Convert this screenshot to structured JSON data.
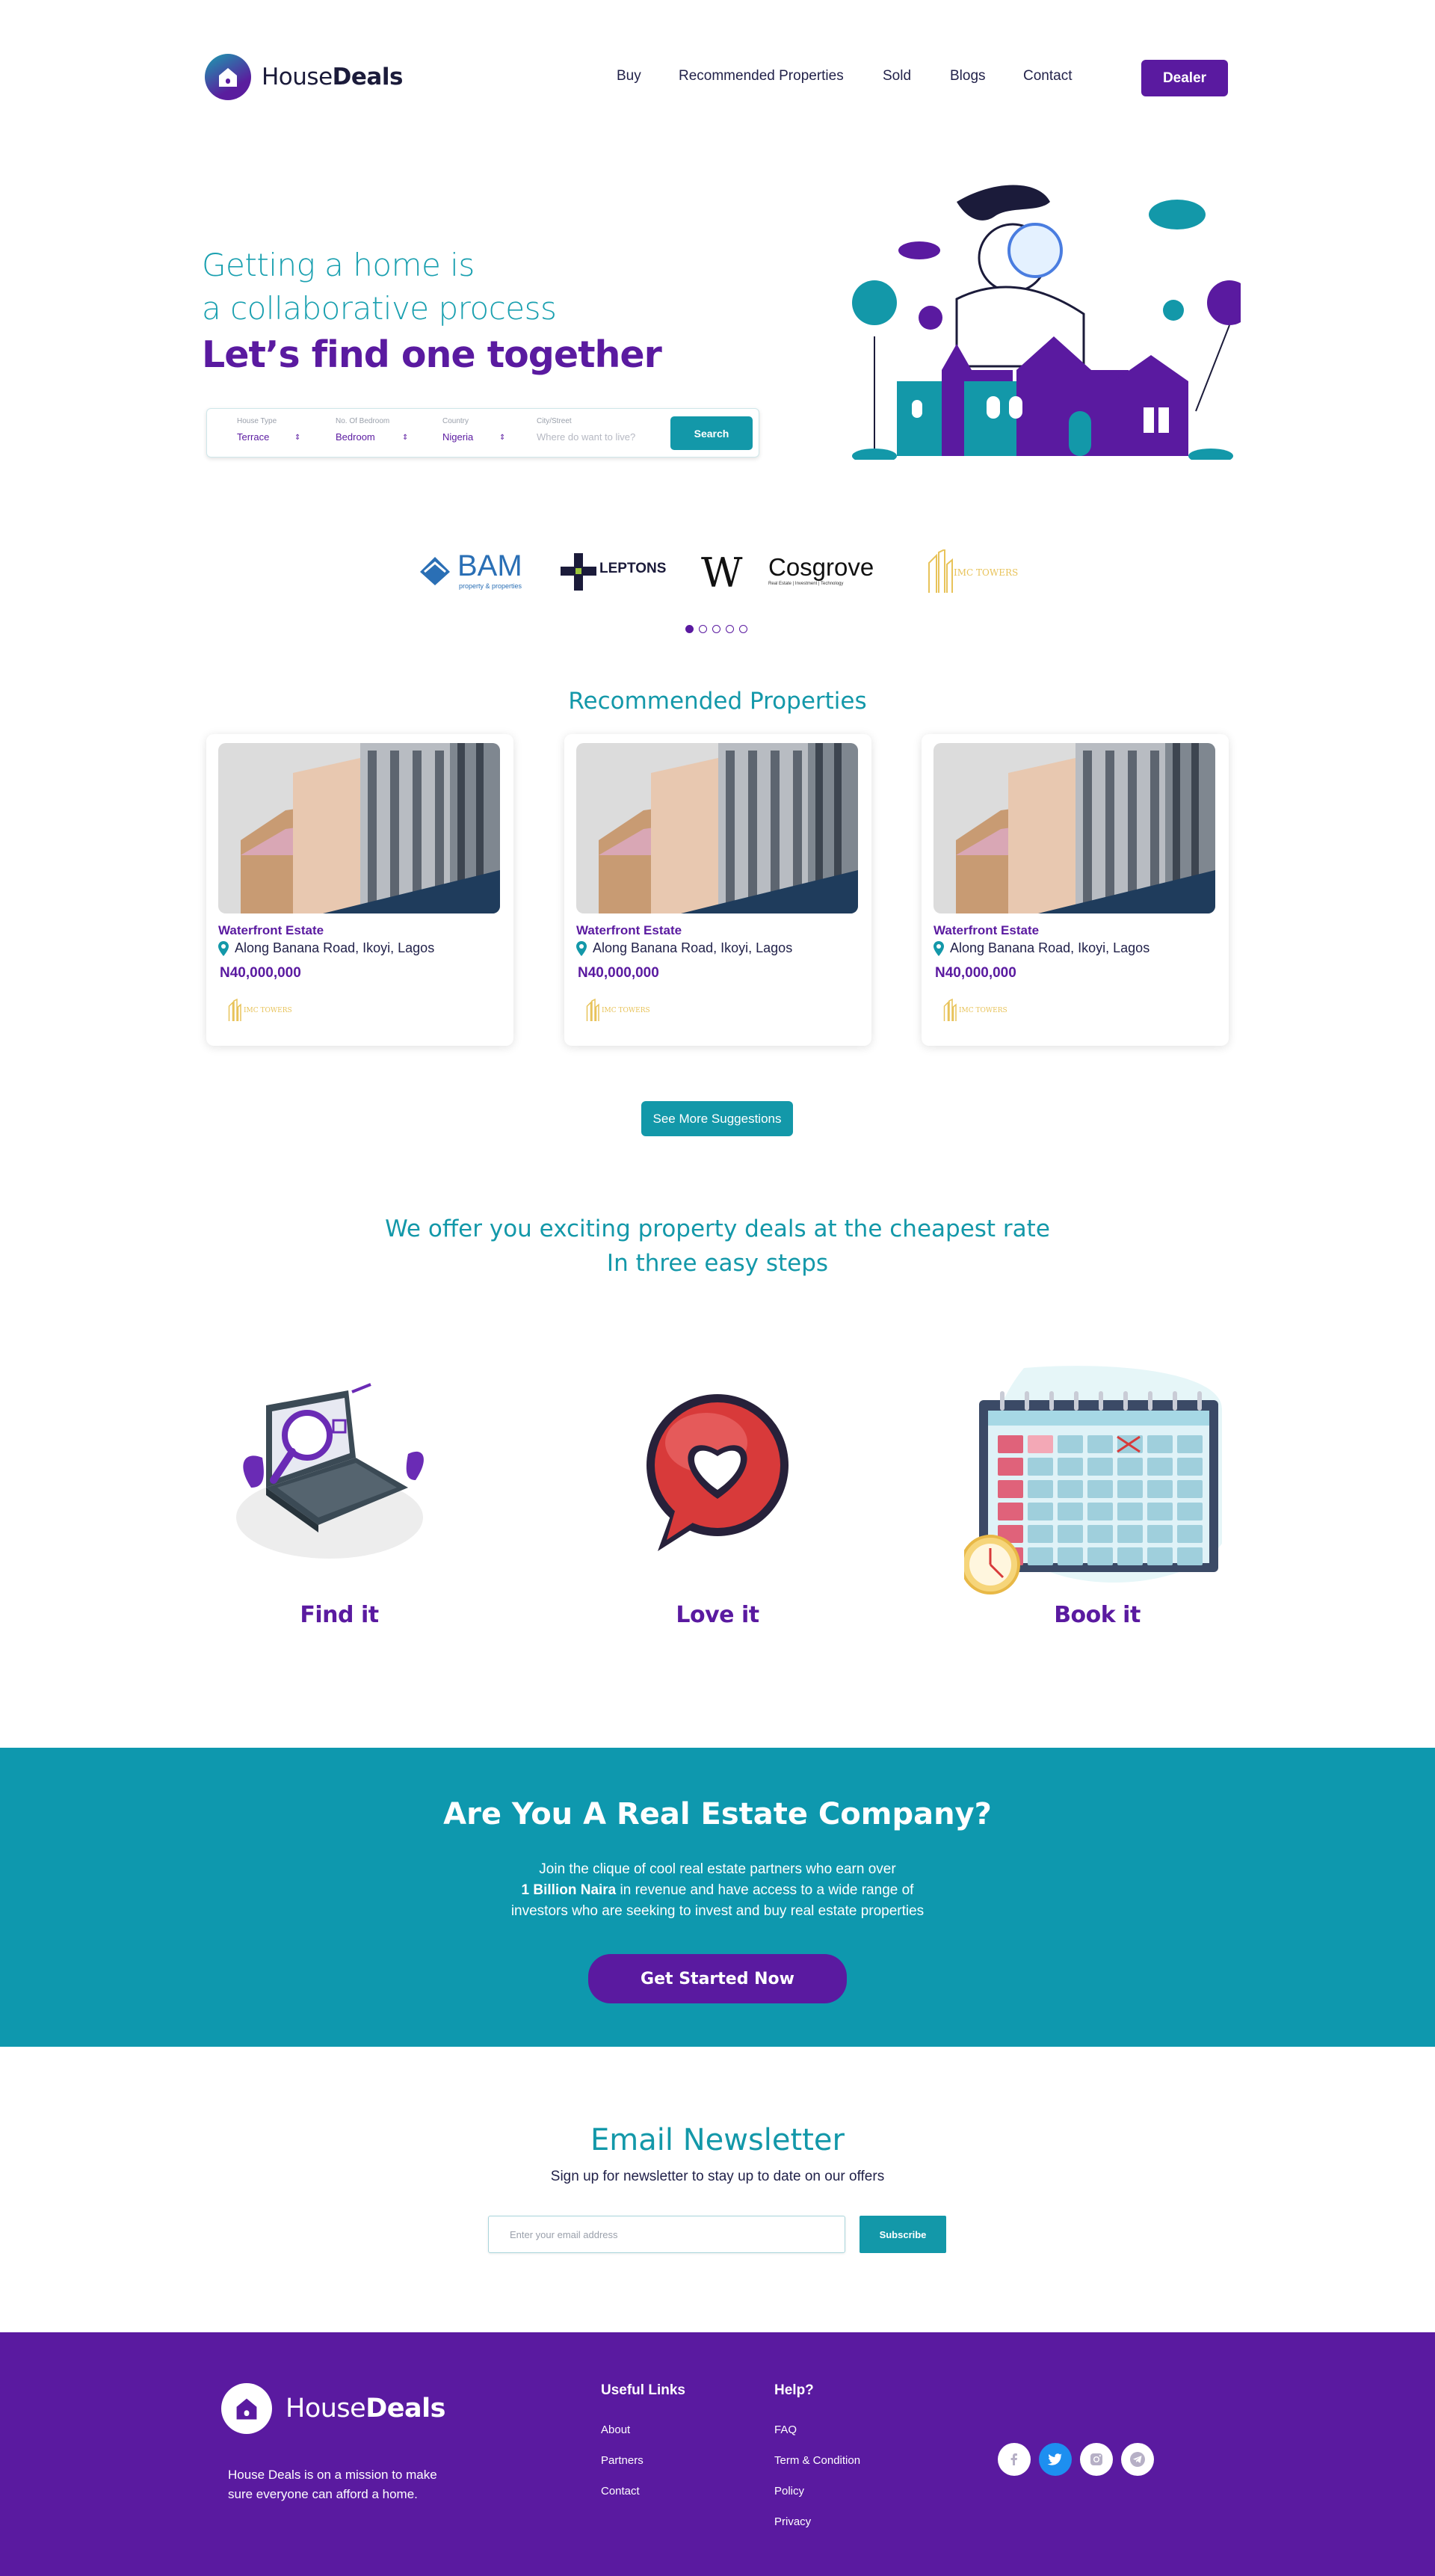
{
  "brand": {
    "name_light": "House",
    "name_bold": "Deals"
  },
  "nav": {
    "links": [
      "Buy",
      "Recommended Properties",
      "Sold",
      "Blogs",
      "Contact"
    ],
    "cta": "Dealer"
  },
  "hero": {
    "line1": "Getting a home is",
    "line2": "a collaborative process",
    "headline": "Let’s find one together"
  },
  "search": {
    "fields": [
      {
        "label": "House Type",
        "value": "Terrace"
      },
      {
        "label": "No. Of Bedroom",
        "value": "Bedroom"
      },
      {
        "label": "Country",
        "value": "Nigeria"
      }
    ],
    "city_label": "City/Street",
    "city_placeholder": "Where do want to live?",
    "button": "Search"
  },
  "partners": {
    "logos": [
      {
        "name": "BAM",
        "sub": "property & properties",
        "icon": "bam-logo"
      },
      {
        "name": "LEPTONS",
        "icon": "leptons-logo"
      },
      {
        "name": "W",
        "icon": "w-logo"
      },
      {
        "name": "Cosgrove",
        "sub": "Real Estate | Investment | Technology",
        "icon": "cosgrove-logo"
      },
      {
        "name": "IMC TOWERS",
        "icon": "imc-towers-logo"
      }
    ],
    "carousel_pages": 5,
    "active_page": 1
  },
  "recommended": {
    "title": "Recommended Properties",
    "cards": [
      {
        "name": "Waterfront Estate",
        "address": "Along Banana Road, Ikoyi, Lagos",
        "price": "N40,000,000",
        "partner": "IMC TOWERS"
      },
      {
        "name": "Waterfront Estate",
        "address": "Along Banana Road, Ikoyi, Lagos",
        "price": "N40,000,000",
        "partner": "IMC TOWERS"
      },
      {
        "name": "Waterfront Estate",
        "address": "Along Banana Road, Ikoyi, Lagos",
        "price": "N40,000,000",
        "partner": "IMC TOWERS"
      }
    ],
    "more_button": "See More Suggestions"
  },
  "offer": {
    "line1": "We offer you exciting property deals at the cheapest rate",
    "line2": "In three easy steps",
    "steps": [
      {
        "label": "Find it",
        "icon": "laptop-search-icon"
      },
      {
        "label": "Love it",
        "icon": "heart-chat-icon"
      },
      {
        "label": "Book it",
        "icon": "calendar-icon"
      }
    ]
  },
  "cta": {
    "title": "Are You A Real Estate Company?",
    "text1": "Join the clique of cool real estate partners who earn over",
    "text2_bold": "1 Billion Naira",
    "text2_rest": " in revenue and have access to a wide range of",
    "text3": "investors who are seeking to invest and buy real estate properties",
    "button": "Get Started Now"
  },
  "newsletter": {
    "title": "Email Newsletter",
    "subtitle": "Sign up for newsletter to stay up to date on our offers",
    "placeholder": "Enter your email address",
    "button": "Subscribe"
  },
  "footer": {
    "mission_line1": "House Deals is on a mission to make",
    "mission_line2": "sure everyone can afford a home.",
    "useful_title": "Useful Links",
    "useful_links": [
      "About",
      "Partners",
      "Contact"
    ],
    "help_title": "Help?",
    "help_links": [
      "FAQ",
      "Term & Condition",
      "Policy",
      "Privacy"
    ],
    "socials": [
      "facebook-icon",
      "twitter-icon",
      "instagram-icon",
      "telegram-icon"
    ]
  },
  "colors": {
    "purple": "#5a1aa0",
    "teal": "#1398a9",
    "cta_bg": "#0e98ae",
    "navy": "#1b1b3a"
  }
}
